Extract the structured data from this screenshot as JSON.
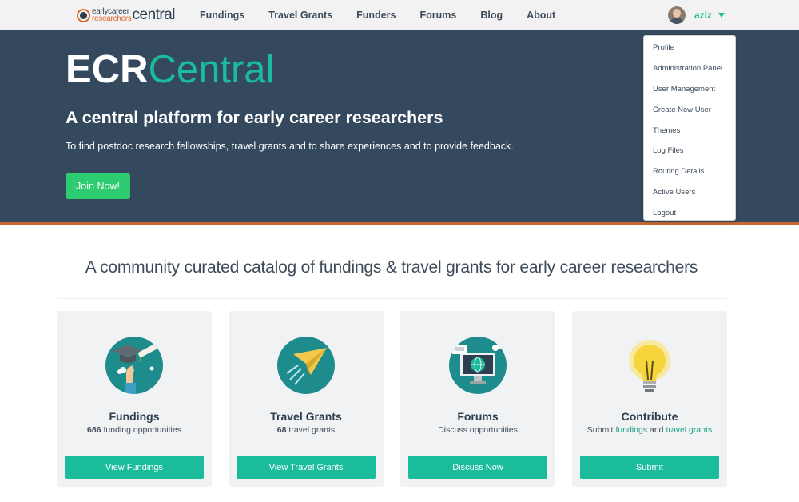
{
  "logo": {
    "line1": "earlycareer",
    "line2": "researchers",
    "big": "central"
  },
  "nav": {
    "items": [
      {
        "label": "Fundings"
      },
      {
        "label": "Travel Grants"
      },
      {
        "label": "Funders"
      },
      {
        "label": "Forums"
      },
      {
        "label": "Blog"
      },
      {
        "label": "About"
      }
    ]
  },
  "user": {
    "name": "aziz"
  },
  "dropdown": {
    "items": [
      {
        "label": "Profile"
      },
      {
        "label": "Administration Panel"
      },
      {
        "label": "User Management"
      },
      {
        "label": "Create New User"
      },
      {
        "label": "Themes"
      },
      {
        "label": "Log Files"
      },
      {
        "label": "Routing Details"
      },
      {
        "label": "Active Users"
      },
      {
        "label": "Logout"
      }
    ]
  },
  "hero": {
    "title_part1": "ECR",
    "title_part2": "Central",
    "subtitle": "A central platform for early career researchers",
    "description": "To find postdoc research fellowships, travel grants and to share experiences and to provide feedback.",
    "join_label": "Join Now!"
  },
  "catalog": {
    "heading": "A community curated catalog of fundings & travel grants for early career researchers",
    "cards": [
      {
        "title": "Fundings",
        "count": "686",
        "text": "funding opportunities",
        "button": "View Fundings",
        "icon": "graduation-cap-icon"
      },
      {
        "title": "Travel Grants",
        "count": "68",
        "text": "travel grants",
        "button": "View Travel Grants",
        "icon": "paper-plane-icon"
      },
      {
        "title": "Forums",
        "text": "Discuss opportunities",
        "button": "Discuss Now",
        "icon": "monitor-globe-icon"
      },
      {
        "title": "Contribute",
        "text_prefix": "Submit",
        "link1": "fundings",
        "text_mid": "and",
        "link2": "travel grants",
        "button": "Submit",
        "icon": "lightbulb-icon"
      }
    ]
  },
  "colors": {
    "accent": "#1abc9c",
    "hero_bg": "#34495e",
    "join_button": "#2ecc71",
    "hero_border": "#c8692e"
  }
}
